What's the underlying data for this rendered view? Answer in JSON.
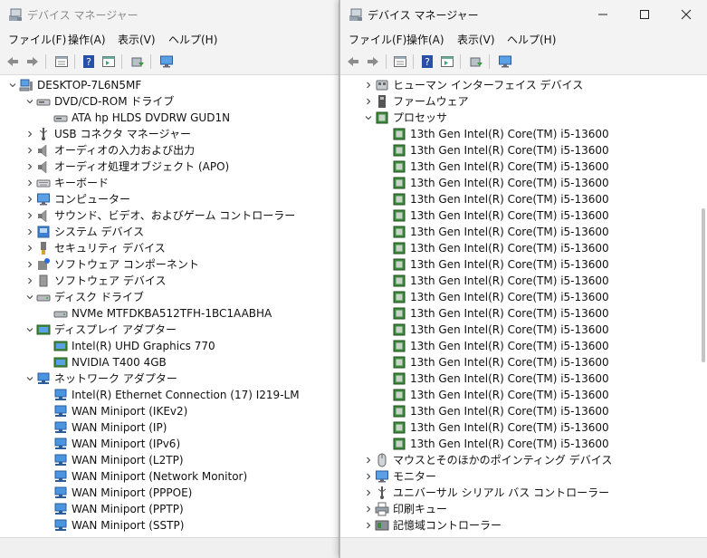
{
  "left_window": {
    "title": "デバイス マネージャー",
    "menu": [
      "ファイル(F)",
      "操作(A)",
      "表示(V)",
      "ヘルプ(H)"
    ],
    "tree": [
      {
        "level": 0,
        "label": "DESKTOP-7L6N5MF",
        "expander": "expanded",
        "icon": "computer-icon"
      },
      {
        "level": 1,
        "label": "DVD/CD-ROM ドライブ",
        "expander": "expanded",
        "icon": "dvd-drive-icon"
      },
      {
        "level": 2,
        "label": "ATA hp HLDS  DVDRW  GUD1N",
        "expander": "none",
        "icon": "dvd-drive-icon"
      },
      {
        "level": 1,
        "label": "USB コネクタ マネージャー",
        "expander": "collapsed",
        "icon": "usb-icon"
      },
      {
        "level": 1,
        "label": "オーディオの入力および出力",
        "expander": "collapsed",
        "icon": "speaker-icon"
      },
      {
        "level": 1,
        "label": "オーディオ処理オブジェクト (APO)",
        "expander": "collapsed",
        "icon": "speaker-icon"
      },
      {
        "level": 1,
        "label": "キーボード",
        "expander": "collapsed",
        "icon": "keyboard-icon"
      },
      {
        "level": 1,
        "label": "コンピューター",
        "expander": "collapsed",
        "icon": "monitor-icon"
      },
      {
        "level": 1,
        "label": "サウンド、ビデオ、およびゲーム コントローラー",
        "expander": "collapsed",
        "icon": "speaker-icon"
      },
      {
        "level": 1,
        "label": "システム デバイス",
        "expander": "collapsed",
        "icon": "system-device-icon"
      },
      {
        "level": 1,
        "label": "セキュリティ デバイス",
        "expander": "collapsed",
        "icon": "security-key-icon"
      },
      {
        "level": 1,
        "label": "ソフトウェア コンポーネント",
        "expander": "collapsed",
        "icon": "puzzle-icon"
      },
      {
        "level": 1,
        "label": "ソフトウェア デバイス",
        "expander": "collapsed",
        "icon": "software-device-icon"
      },
      {
        "level": 1,
        "label": "ディスク ドライブ",
        "expander": "expanded",
        "icon": "disk-drive-icon"
      },
      {
        "level": 2,
        "label": "NVMe MTFDKBA512TFH-1BC1AABHA",
        "expander": "none",
        "icon": "disk-drive-icon"
      },
      {
        "level": 1,
        "label": "ディスプレイ アダプター",
        "expander": "expanded",
        "icon": "display-adapter-icon"
      },
      {
        "level": 2,
        "label": "Intel(R) UHD Graphics 770",
        "expander": "none",
        "icon": "display-adapter-icon"
      },
      {
        "level": 2,
        "label": "NVIDIA T400 4GB",
        "expander": "none",
        "icon": "display-adapter-icon"
      },
      {
        "level": 1,
        "label": "ネットワーク アダプター",
        "expander": "expanded",
        "icon": "network-adapter-icon"
      },
      {
        "level": 2,
        "label": "Intel(R) Ethernet Connection (17) I219-LM",
        "expander": "none",
        "icon": "network-adapter-icon"
      },
      {
        "level": 2,
        "label": "WAN Miniport (IKEv2)",
        "expander": "none",
        "icon": "network-adapter-icon"
      },
      {
        "level": 2,
        "label": "WAN Miniport (IP)",
        "expander": "none",
        "icon": "network-adapter-icon"
      },
      {
        "level": 2,
        "label": "WAN Miniport (IPv6)",
        "expander": "none",
        "icon": "network-adapter-icon"
      },
      {
        "level": 2,
        "label": "WAN Miniport (L2TP)",
        "expander": "none",
        "icon": "network-adapter-icon"
      },
      {
        "level": 2,
        "label": "WAN Miniport (Network Monitor)",
        "expander": "none",
        "icon": "network-adapter-icon"
      },
      {
        "level": 2,
        "label": "WAN Miniport (PPPOE)",
        "expander": "none",
        "icon": "network-adapter-icon"
      },
      {
        "level": 2,
        "label": "WAN Miniport (PPTP)",
        "expander": "none",
        "icon": "network-adapter-icon"
      },
      {
        "level": 2,
        "label": "WAN Miniport (SSTP)",
        "expander": "none",
        "icon": "network-adapter-icon"
      }
    ]
  },
  "right_window": {
    "title": "デバイス マネージャー",
    "menu": [
      "ファイル(F)",
      "操作(A)",
      "表示(V)",
      "ヘルプ(H)"
    ],
    "tree": [
      {
        "level": 1,
        "label": "ヒューマン インターフェイス デバイス",
        "expander": "collapsed",
        "icon": "hid-icon"
      },
      {
        "level": 1,
        "label": "ファームウェア",
        "expander": "collapsed",
        "icon": "firmware-icon"
      },
      {
        "level": 1,
        "label": "プロセッサ",
        "expander": "expanded",
        "icon": "processor-icon"
      },
      {
        "level": 2,
        "label": "13th Gen Intel(R) Core(TM) i5-13600",
        "expander": "none",
        "icon": "processor-icon"
      },
      {
        "level": 2,
        "label": "13th Gen Intel(R) Core(TM) i5-13600",
        "expander": "none",
        "icon": "processor-icon"
      },
      {
        "level": 2,
        "label": "13th Gen Intel(R) Core(TM) i5-13600",
        "expander": "none",
        "icon": "processor-icon"
      },
      {
        "level": 2,
        "label": "13th Gen Intel(R) Core(TM) i5-13600",
        "expander": "none",
        "icon": "processor-icon"
      },
      {
        "level": 2,
        "label": "13th Gen Intel(R) Core(TM) i5-13600",
        "expander": "none",
        "icon": "processor-icon"
      },
      {
        "level": 2,
        "label": "13th Gen Intel(R) Core(TM) i5-13600",
        "expander": "none",
        "icon": "processor-icon"
      },
      {
        "level": 2,
        "label": "13th Gen Intel(R) Core(TM) i5-13600",
        "expander": "none",
        "icon": "processor-icon"
      },
      {
        "level": 2,
        "label": "13th Gen Intel(R) Core(TM) i5-13600",
        "expander": "none",
        "icon": "processor-icon"
      },
      {
        "level": 2,
        "label": "13th Gen Intel(R) Core(TM) i5-13600",
        "expander": "none",
        "icon": "processor-icon"
      },
      {
        "level": 2,
        "label": "13th Gen Intel(R) Core(TM) i5-13600",
        "expander": "none",
        "icon": "processor-icon"
      },
      {
        "level": 2,
        "label": "13th Gen Intel(R) Core(TM) i5-13600",
        "expander": "none",
        "icon": "processor-icon"
      },
      {
        "level": 2,
        "label": "13th Gen Intel(R) Core(TM) i5-13600",
        "expander": "none",
        "icon": "processor-icon"
      },
      {
        "level": 2,
        "label": "13th Gen Intel(R) Core(TM) i5-13600",
        "expander": "none",
        "icon": "processor-icon"
      },
      {
        "level": 2,
        "label": "13th Gen Intel(R) Core(TM) i5-13600",
        "expander": "none",
        "icon": "processor-icon"
      },
      {
        "level": 2,
        "label": "13th Gen Intel(R) Core(TM) i5-13600",
        "expander": "none",
        "icon": "processor-icon"
      },
      {
        "level": 2,
        "label": "13th Gen Intel(R) Core(TM) i5-13600",
        "expander": "none",
        "icon": "processor-icon"
      },
      {
        "level": 2,
        "label": "13th Gen Intel(R) Core(TM) i5-13600",
        "expander": "none",
        "icon": "processor-icon"
      },
      {
        "level": 2,
        "label": "13th Gen Intel(R) Core(TM) i5-13600",
        "expander": "none",
        "icon": "processor-icon"
      },
      {
        "level": 2,
        "label": "13th Gen Intel(R) Core(TM) i5-13600",
        "expander": "none",
        "icon": "processor-icon"
      },
      {
        "level": 2,
        "label": "13th Gen Intel(R) Core(TM) i5-13600",
        "expander": "none",
        "icon": "processor-icon"
      },
      {
        "level": 1,
        "label": "マウスとそのほかのポインティング デバイス",
        "expander": "collapsed",
        "icon": "mouse-icon"
      },
      {
        "level": 1,
        "label": "モニター",
        "expander": "collapsed",
        "icon": "monitor-icon"
      },
      {
        "level": 1,
        "label": "ユニバーサル シリアル バス コントローラー",
        "expander": "collapsed",
        "icon": "usb-icon"
      },
      {
        "level": 1,
        "label": "印刷キュー",
        "expander": "collapsed",
        "icon": "printer-icon"
      },
      {
        "level": 1,
        "label": "記憶域コントローラー",
        "expander": "collapsed",
        "icon": "storage-controller-icon"
      }
    ]
  },
  "colors": {
    "accent": "#2e6bd6",
    "processor_green": "#3d8b3d",
    "title_bar": "#f3f3f3"
  }
}
